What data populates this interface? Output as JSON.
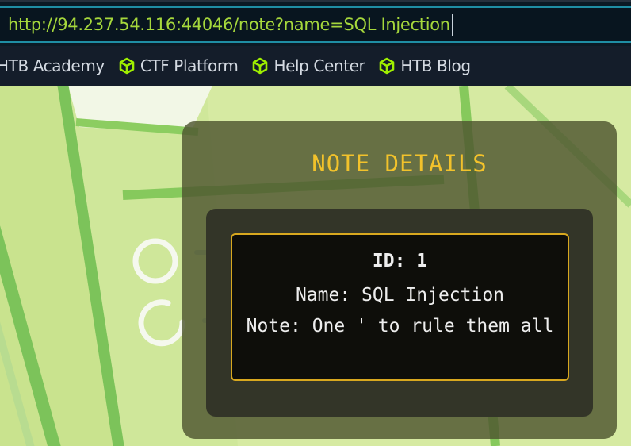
{
  "address_bar": {
    "url": "http://94.237.54.116:44046/note?name=SQL Injection"
  },
  "bookmarks": [
    {
      "label": "HTB Academy",
      "icon": "cube-icon"
    },
    {
      "label": "CTF Platform",
      "icon": "cube-icon"
    },
    {
      "label": "Help Center",
      "icon": "cube-icon"
    },
    {
      "label": "HTB Blog",
      "icon": "cube-icon"
    }
  ],
  "note_card": {
    "title": "NOTE DETAILS",
    "id_line": "ID: 1",
    "name_line": "Name: SQL Injection",
    "note_line": "Note: One ' to rule them all"
  },
  "colors": {
    "url_text": "#a6d83c",
    "bookmark_icon": "#9fef00",
    "title": "#f2c22b",
    "note_border": "#d8a81f",
    "page_bg": "#dcedab"
  }
}
